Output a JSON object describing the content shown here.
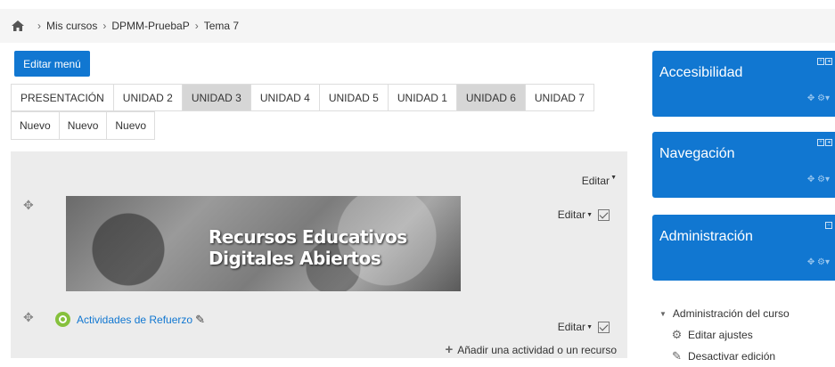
{
  "breadcrumb": {
    "items": [
      "Mis cursos",
      "DPMM-PruebaP",
      "Tema 7"
    ],
    "separator": "›"
  },
  "edit_menu_label": "Editar menú",
  "tabs": [
    {
      "label": "PRESENTACIÓN",
      "active": false
    },
    {
      "label": "UNIDAD 2",
      "active": false
    },
    {
      "label": "UNIDAD 3",
      "active": true
    },
    {
      "label": "UNIDAD 4",
      "active": false
    },
    {
      "label": "UNIDAD 5",
      "active": false
    },
    {
      "label": "UNIDAD 1",
      "active": false
    },
    {
      "label": "UNIDAD 6",
      "active": true
    },
    {
      "label": "UNIDAD 7",
      "active": false
    }
  ],
  "new_tabs": [
    "Nuevo",
    "Nuevo",
    "Nuevo"
  ],
  "section": {
    "editar_label": "Editar",
    "banner_text_line1": "Recursos Educativos",
    "banner_text_line2": "Digitales Abiertos",
    "activity_label": "Actividades de Refuerzo",
    "add_activity_label": "Añadir una actividad o un recurso"
  },
  "blocks": [
    {
      "title": "Accesibilidad"
    },
    {
      "title": "Navegación"
    },
    {
      "title": "Administración"
    }
  ],
  "admin_tree": {
    "root": "Administración del curso",
    "items": [
      "Editar ajustes",
      "Desactivar edición"
    ]
  },
  "colors": {
    "accent": "#1177d1",
    "activity_icon": "#86c13d",
    "section_bg": "#ececec"
  }
}
